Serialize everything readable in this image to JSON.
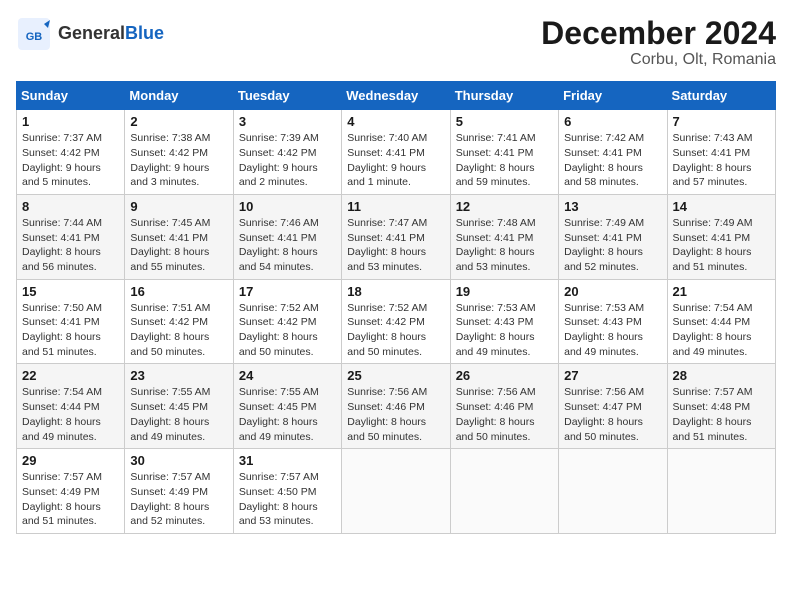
{
  "header": {
    "logo_general": "General",
    "logo_blue": "Blue",
    "title": "December 2024",
    "subtitle": "Corbu, Olt, Romania"
  },
  "calendar": {
    "days_of_week": [
      "Sunday",
      "Monday",
      "Tuesday",
      "Wednesday",
      "Thursday",
      "Friday",
      "Saturday"
    ],
    "weeks": [
      [
        {
          "day": "1",
          "sunrise": "7:37 AM",
          "sunset": "4:42 PM",
          "daylight": "9 hours and 5 minutes."
        },
        {
          "day": "2",
          "sunrise": "7:38 AM",
          "sunset": "4:42 PM",
          "daylight": "9 hours and 3 minutes."
        },
        {
          "day": "3",
          "sunrise": "7:39 AM",
          "sunset": "4:42 PM",
          "daylight": "9 hours and 2 minutes."
        },
        {
          "day": "4",
          "sunrise": "7:40 AM",
          "sunset": "4:41 PM",
          "daylight": "9 hours and 1 minute."
        },
        {
          "day": "5",
          "sunrise": "7:41 AM",
          "sunset": "4:41 PM",
          "daylight": "8 hours and 59 minutes."
        },
        {
          "day": "6",
          "sunrise": "7:42 AM",
          "sunset": "4:41 PM",
          "daylight": "8 hours and 58 minutes."
        },
        {
          "day": "7",
          "sunrise": "7:43 AM",
          "sunset": "4:41 PM",
          "daylight": "8 hours and 57 minutes."
        }
      ],
      [
        {
          "day": "8",
          "sunrise": "7:44 AM",
          "sunset": "4:41 PM",
          "daylight": "8 hours and 56 minutes."
        },
        {
          "day": "9",
          "sunrise": "7:45 AM",
          "sunset": "4:41 PM",
          "daylight": "8 hours and 55 minutes."
        },
        {
          "day": "10",
          "sunrise": "7:46 AM",
          "sunset": "4:41 PM",
          "daylight": "8 hours and 54 minutes."
        },
        {
          "day": "11",
          "sunrise": "7:47 AM",
          "sunset": "4:41 PM",
          "daylight": "8 hours and 53 minutes."
        },
        {
          "day": "12",
          "sunrise": "7:48 AM",
          "sunset": "4:41 PM",
          "daylight": "8 hours and 53 minutes."
        },
        {
          "day": "13",
          "sunrise": "7:49 AM",
          "sunset": "4:41 PM",
          "daylight": "8 hours and 52 minutes."
        },
        {
          "day": "14",
          "sunrise": "7:49 AM",
          "sunset": "4:41 PM",
          "daylight": "8 hours and 51 minutes."
        }
      ],
      [
        {
          "day": "15",
          "sunrise": "7:50 AM",
          "sunset": "4:41 PM",
          "daylight": "8 hours and 51 minutes."
        },
        {
          "day": "16",
          "sunrise": "7:51 AM",
          "sunset": "4:42 PM",
          "daylight": "8 hours and 50 minutes."
        },
        {
          "day": "17",
          "sunrise": "7:52 AM",
          "sunset": "4:42 PM",
          "daylight": "8 hours and 50 minutes."
        },
        {
          "day": "18",
          "sunrise": "7:52 AM",
          "sunset": "4:42 PM",
          "daylight": "8 hours and 50 minutes."
        },
        {
          "day": "19",
          "sunrise": "7:53 AM",
          "sunset": "4:43 PM",
          "daylight": "8 hours and 49 minutes."
        },
        {
          "day": "20",
          "sunrise": "7:53 AM",
          "sunset": "4:43 PM",
          "daylight": "8 hours and 49 minutes."
        },
        {
          "day": "21",
          "sunrise": "7:54 AM",
          "sunset": "4:44 PM",
          "daylight": "8 hours and 49 minutes."
        }
      ],
      [
        {
          "day": "22",
          "sunrise": "7:54 AM",
          "sunset": "4:44 PM",
          "daylight": "8 hours and 49 minutes."
        },
        {
          "day": "23",
          "sunrise": "7:55 AM",
          "sunset": "4:45 PM",
          "daylight": "8 hours and 49 minutes."
        },
        {
          "day": "24",
          "sunrise": "7:55 AM",
          "sunset": "4:45 PM",
          "daylight": "8 hours and 49 minutes."
        },
        {
          "day": "25",
          "sunrise": "7:56 AM",
          "sunset": "4:46 PM",
          "daylight": "8 hours and 50 minutes."
        },
        {
          "day": "26",
          "sunrise": "7:56 AM",
          "sunset": "4:46 PM",
          "daylight": "8 hours and 50 minutes."
        },
        {
          "day": "27",
          "sunrise": "7:56 AM",
          "sunset": "4:47 PM",
          "daylight": "8 hours and 50 minutes."
        },
        {
          "day": "28",
          "sunrise": "7:57 AM",
          "sunset": "4:48 PM",
          "daylight": "8 hours and 51 minutes."
        }
      ],
      [
        {
          "day": "29",
          "sunrise": "7:57 AM",
          "sunset": "4:49 PM",
          "daylight": "8 hours and 51 minutes."
        },
        {
          "day": "30",
          "sunrise": "7:57 AM",
          "sunset": "4:49 PM",
          "daylight": "8 hours and 52 minutes."
        },
        {
          "day": "31",
          "sunrise": "7:57 AM",
          "sunset": "4:50 PM",
          "daylight": "8 hours and 53 minutes."
        },
        null,
        null,
        null,
        null
      ]
    ]
  }
}
